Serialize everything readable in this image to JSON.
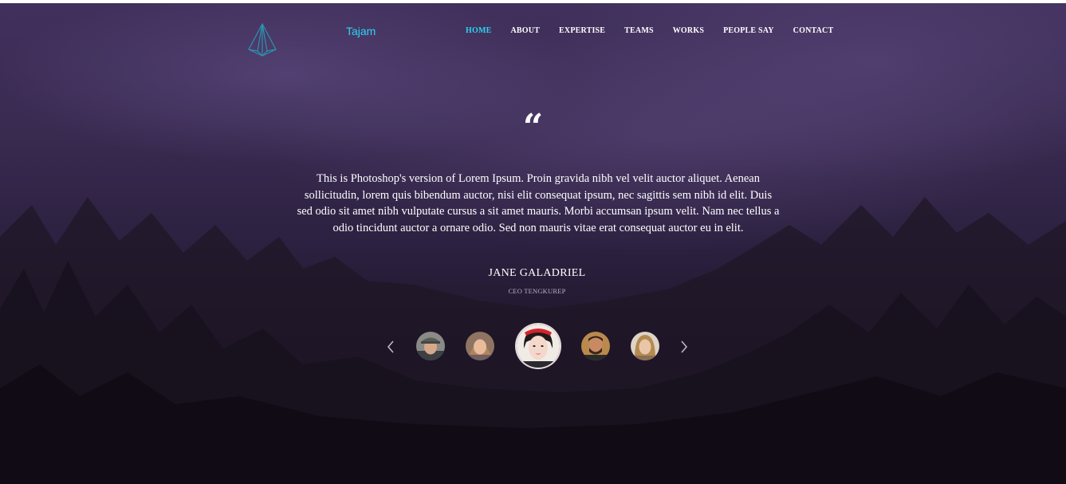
{
  "header": {
    "brand": "Tajam",
    "logo_icon": "diamond-prism-icon",
    "nav": [
      {
        "label": "HOME",
        "active": true
      },
      {
        "label": "ABOUT",
        "active": false
      },
      {
        "label": "EXPERTISE",
        "active": false
      },
      {
        "label": "TEAMS",
        "active": false
      },
      {
        "label": "WORKS",
        "active": false
      },
      {
        "label": "PEOPLE SAY",
        "active": false
      },
      {
        "label": "CONTACT",
        "active": false
      }
    ]
  },
  "testimonial": {
    "quote_mark": "“",
    "text": "This is Photoshop's version of Lorem Ipsum. Proin gravida nibh vel velit auctor aliquet. Aenean sollicitudin, lorem quis bibendum auctor, nisi elit consequat ipsum, nec sagittis sem nibh id elit. Duis sed odio sit amet nibh vulputate cursus a sit amet mauris. Morbi accumsan ipsum velit. Nam nec tellus a odio tincidunt auctor a ornare odio. Sed non mauris vitae erat consequat auctor eu in elit.",
    "author_name": "JANE GALADRIEL",
    "author_role": "CEO TENGKUREP"
  },
  "carousel": {
    "prev_icon": "chevron-left-icon",
    "next_icon": "chevron-right-icon",
    "avatars": [
      {
        "name": "avatar-1",
        "selected": false
      },
      {
        "name": "avatar-2",
        "selected": false
      },
      {
        "name": "avatar-3",
        "selected": true
      },
      {
        "name": "avatar-4",
        "selected": false
      },
      {
        "name": "avatar-5",
        "selected": false
      }
    ]
  },
  "colors": {
    "accent": "#2bd4f0",
    "text": "#ffffff",
    "background_top": "#41305c",
    "background_bottom": "#140e1b"
  }
}
